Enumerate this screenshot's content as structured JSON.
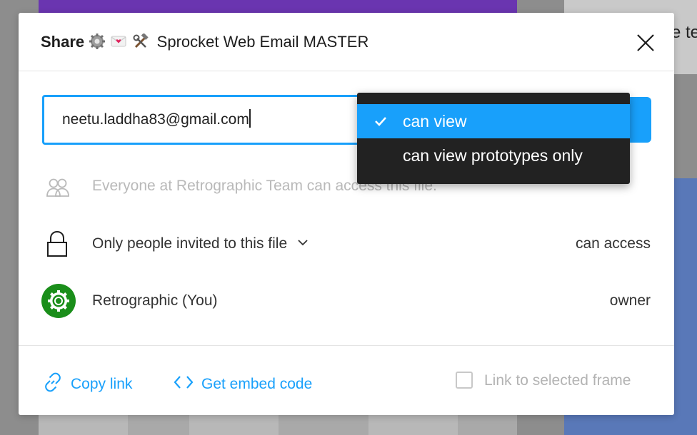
{
  "background": {
    "partial_text": "e te"
  },
  "modal": {
    "share_label": "Share",
    "file_name": "Sprocket Web Email MASTER",
    "title_icons": [
      "gear-emoji",
      "envelope-emoji",
      "tools-emoji"
    ]
  },
  "invite": {
    "email_value": "neetu.laddha83@gmail.com"
  },
  "permission_menu": {
    "items": [
      {
        "label": "can view",
        "selected": true
      },
      {
        "label": "can view prototypes only",
        "selected": false
      }
    ]
  },
  "team_row": {
    "text": "Everyone at Retrographic Team can access this file."
  },
  "access_row": {
    "text": "Only people invited to this file",
    "right": "can access"
  },
  "owner_row": {
    "name": "Retrographic (You)",
    "role": "owner"
  },
  "footer": {
    "copy_link": "Copy link",
    "embed_code": "Get embed code",
    "frame_checkbox_label": "Link to selected frame",
    "frame_checkbox_checked": false
  },
  "colors": {
    "accent": "#18a0fb",
    "menu_bg": "#222222",
    "avatar_green": "#1a8e1a"
  }
}
